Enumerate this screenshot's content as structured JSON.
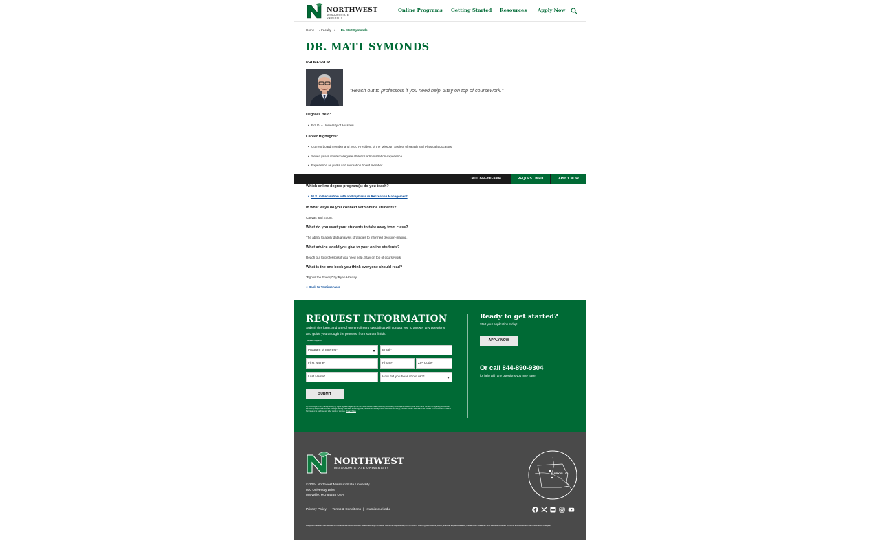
{
  "header": {
    "logo_word": "NORTHWEST",
    "logo_sub": "MISSOURI STATE UNIVERSITY",
    "nav": [
      "Online Programs",
      "Getting Started",
      "Resources",
      "Apply Now"
    ]
  },
  "breadcrumb": {
    "home": "Home",
    "faculty": "/ Faculty",
    "current": "Dr. Matt Symonds"
  },
  "profile": {
    "name": "DR. MATT SYMONDS",
    "role": "PROFESSOR",
    "quote": "\"Reach out to professors if you need help. Stay on top of coursework.\""
  },
  "degrees": {
    "heading": "Degrees Held:",
    "items": [
      "Ed. D. – University of Missouri"
    ]
  },
  "career": {
    "heading": "Career Highlights:",
    "items": [
      "Current board member and 2010 President of the Missouri Society of Health and Physical Educators",
      "Seven years of intercollegiate athletics administration experience",
      "Experience as parks and recreation board member"
    ]
  },
  "sticky_bar": {
    "call": "CALL 844-890-9304",
    "request": "REQUEST INFO",
    "apply": "APPLY NOW"
  },
  "qa": [
    {
      "q": "Which online degree program(s) do you teach?",
      "a": "M.S. in Recreation with an Emphasis in Recreation Management"
    },
    {
      "q": "In what ways do you connect with online students?",
      "a": "Canvas and Zoom."
    },
    {
      "q": "What do you want your students to take away from class?",
      "a": "The ability to apply data analysis strategies to informed decision-making."
    },
    {
      "q": "What advice would you give to your online students?",
      "a": "Reach out to professors if you need help. Stay on top of coursework."
    },
    {
      "q": "What is the one book you think everyone should read?",
      "a": "\"Ego is the Enemy\" by Ryan Holiday"
    }
  ],
  "back_link": "« Back to Testimonials",
  "request_info": {
    "title": "REQUEST INFORMATION",
    "intro": "Submit this form, and one of our enrollment specialists will contact you to answer any questions and guide you through the process, from start to finish.",
    "required_note": "*All fields required",
    "fields": {
      "program": "Program of Interest*",
      "email": "Email*",
      "first_name": "First Name*",
      "phone": "Phone*",
      "zip": "ZIP Code*",
      "last_name": "Last Name*",
      "heard": "How did you hear about us?*"
    },
    "submit": "SUBMIT",
    "consent": "By submitting this form, I am providing my digital signature agreeing that Northwest Missouri State University (Northwest) and its agent, Risepoint, may email me or contact me regarding educational services by telephone and/or text message utilizing automated technology or a pre-recorded message at the telephone number(s) provided above. I understand this consent is not a condition to attend Northwest or to purchase any other goods or services.",
    "consent_link": "Privacy Policy"
  },
  "cta": {
    "ready": "Ready to get started?",
    "ready_sub": "Start your application today!",
    "apply": "APPLY NOW",
    "call": "Or call 844-890-9304",
    "call_sub": "for help with any questions you may have."
  },
  "footer": {
    "logo_word": "NORTHWEST",
    "logo_sub": "MISSOURI STATE UNIVERSITY",
    "address": [
      "© 2024 Northwest Missouri State University",
      "800 University Drive",
      "Maryville, MO 64468 USA"
    ],
    "links": [
      "Privacy Policy",
      "Terms & Conditions",
      "nwmissouri.edu"
    ],
    "disclaimer": "Risepoint maintains this website on behalf of Northwest Missouri State University. Northwest maintains responsibility for curriculum, teaching, admissions, tuition, financial aid, accreditation, and all other academic- and instruction-related functions and decisions.",
    "disclaimer_link": "Learn more about Risepoint",
    "map_label": "MARYVILLE",
    "socials": [
      "facebook-icon",
      "x-icon",
      "flickr-icon",
      "instagram-icon",
      "youtube-icon"
    ]
  },
  "colors": {
    "brand_green": "#006a35",
    "footer_gray": "#4a4a4a",
    "link_blue": "#0b4e9c"
  }
}
